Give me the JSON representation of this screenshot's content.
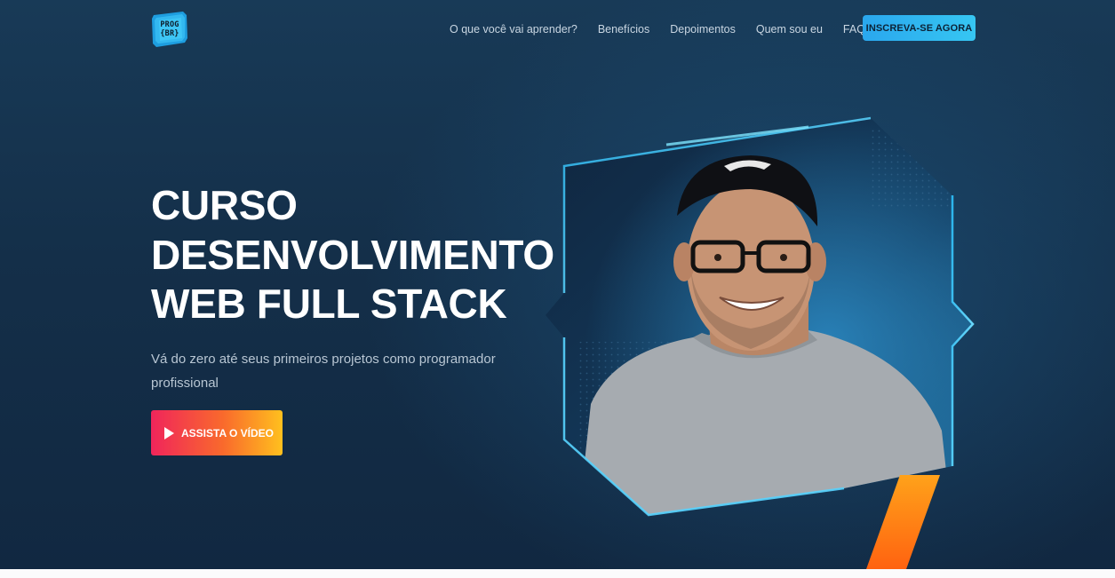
{
  "header": {
    "logo_line1": "PROG",
    "logo_line2": "{BR}",
    "nav": [
      {
        "label": "O que você vai aprender?"
      },
      {
        "label": "Benefícios"
      },
      {
        "label": "Depoimentos"
      },
      {
        "label": "Quem sou eu"
      },
      {
        "label": "FAQ"
      }
    ],
    "cta_label": "INSCREVA-SE AGORA"
  },
  "hero": {
    "title_lines": [
      "CURSO",
      "DESENVOLVIMENTO",
      "WEB FULL STACK"
    ],
    "subtitle": "Vá do zero até seus primeiros projetos como programador profissional",
    "video_button_label": "ASSISTA O VÍDEO"
  },
  "colors": {
    "background": "#142f49",
    "accent_cyan": "#36c6f2",
    "accent_red": "#f0255b",
    "accent_yellow": "#ffc01e"
  }
}
